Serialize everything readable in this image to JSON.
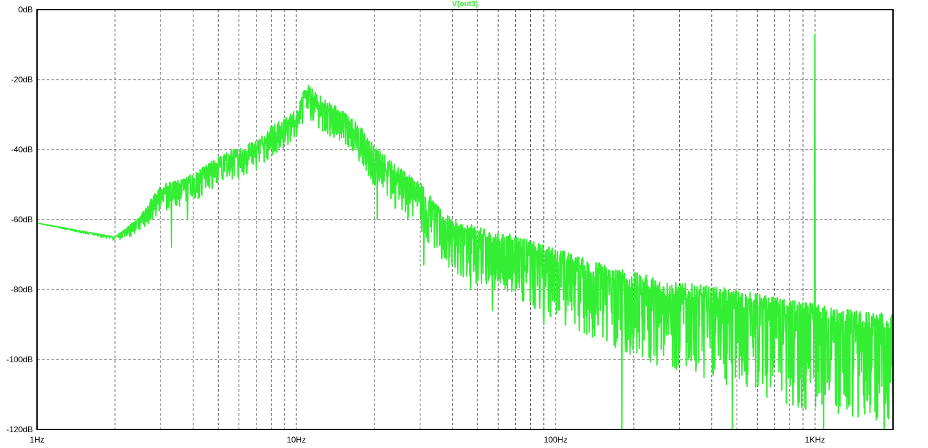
{
  "chart_data": {
    "type": "line",
    "title": "V(out3)",
    "x_scale": "log",
    "xlim": [
      1,
      2000
    ],
    "ylim": [
      -120,
      0
    ],
    "y_unit": "dB",
    "grid": true,
    "x_tick_labels": [
      {
        "value": 1,
        "label": "1Hz"
      },
      {
        "value": 10,
        "label": "10Hz"
      },
      {
        "value": 100,
        "label": "100Hz"
      },
      {
        "value": 1000,
        "label": "1KHz"
      }
    ],
    "y_tick_labels": [
      {
        "value": 0,
        "label": "0dB"
      },
      {
        "value": -20,
        "label": "-20dB"
      },
      {
        "value": -40,
        "label": "-40dB"
      },
      {
        "value": -60,
        "label": "-60dB"
      },
      {
        "value": -80,
        "label": "-80dB"
      },
      {
        "value": -100,
        "label": "-100dB"
      },
      {
        "value": -120,
        "label": "-120dB"
      }
    ],
    "series": [
      {
        "name": "V(out3)",
        "color": "#33ee33",
        "envelope": {
          "x": [
            1,
            2,
            2.5,
            3,
            4,
            5,
            6,
            7,
            8,
            9,
            10,
            11,
            12,
            14,
            16,
            18,
            20,
            25,
            30,
            35,
            40,
            50,
            60,
            70,
            80,
            100,
            130,
            160,
            200,
            300,
            400,
            500,
            600,
            800,
            1000,
            1200,
            1500,
            2000
          ],
          "y_mid": [
            -61,
            -65,
            -60,
            -52,
            -49,
            -44,
            -42,
            -40,
            -36,
            -34,
            -31,
            -24,
            -27,
            -30,
            -33,
            -37,
            -42,
            -48,
            -52,
            -59,
            -63,
            -65,
            -67,
            -68,
            -70,
            -72,
            -75,
            -77,
            -80,
            -83,
            -84,
            -85,
            -86,
            -88,
            -89,
            -90,
            -91,
            -92
          ],
          "dip_depth": [
            0,
            1,
            4,
            6,
            6,
            6,
            6,
            6,
            6,
            6,
            6,
            7,
            7,
            7,
            7,
            8,
            9,
            10,
            11,
            12,
            12,
            14,
            14,
            15,
            16,
            17,
            18,
            19,
            20,
            21,
            22,
            23,
            24,
            25,
            26,
            26,
            26,
            26
          ],
          "peak_height": [
            0,
            0,
            1,
            2,
            2,
            2,
            3,
            3,
            3,
            3,
            3,
            3,
            3,
            3,
            3,
            3,
            3,
            3,
            3,
            3,
            3,
            3,
            3,
            4,
            4,
            4,
            4,
            4,
            5,
            5,
            5,
            5,
            5,
            5,
            5,
            5,
            5,
            5
          ]
        },
        "spikes": [
          {
            "x": 1000,
            "y": -7
          },
          {
            "x": 3.3,
            "y": -68
          },
          {
            "x": 3.8,
            "y": -60
          },
          {
            "x": 20.5,
            "y": -60
          },
          {
            "x": 31,
            "y": -73
          },
          {
            "x": 47,
            "y": -80
          },
          {
            "x": 57,
            "y": -86
          },
          {
            "x": 90,
            "y": -90
          },
          {
            "x": 180,
            "y": -120
          },
          {
            "x": 480,
            "y": -120
          },
          {
            "x": 1080,
            "y": -120
          },
          {
            "x": 1850,
            "y": -120
          }
        ]
      }
    ]
  }
}
